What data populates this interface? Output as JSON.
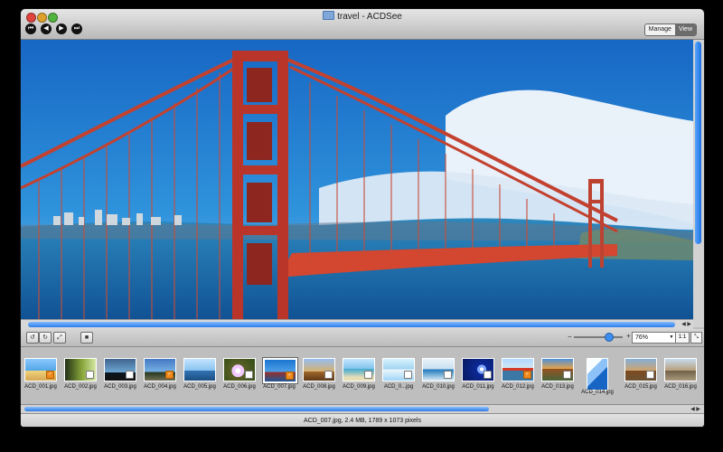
{
  "window": {
    "title": "travel - ACDSee"
  },
  "toolbar": {
    "manage_label": "Manage",
    "view_label": "View"
  },
  "viewer": {
    "zoom_value": "76%",
    "one_to_one_label": "1:1"
  },
  "thumbnails": [
    {
      "label": "ACD_001.jpg"
    },
    {
      "label": "ACD_002.jpg"
    },
    {
      "label": "ACD_003.jpg"
    },
    {
      "label": "ACD_004.jpg"
    },
    {
      "label": "ACD_005.jpg"
    },
    {
      "label": "ACD_006.jpg"
    },
    {
      "label": "ACD_007.jpg"
    },
    {
      "label": "ACD_008.jpg"
    },
    {
      "label": "ACD_009.jpg"
    },
    {
      "label": "ACD_0...jpg"
    },
    {
      "label": "ACD_010.jpg"
    },
    {
      "label": "ACD_011.jpg"
    },
    {
      "label": "ACD_012.jpg"
    },
    {
      "label": "ACD_013.jpg"
    },
    {
      "label": "ACD_014.jpg"
    },
    {
      "label": "ACD_015.jpg"
    },
    {
      "label": "ACD_016.jpg"
    }
  ],
  "status": {
    "text": "ACD_007.jpg, 2.4 MB, 1789 x 1073 pixels"
  },
  "colors": {
    "accent": "#2b7dea",
    "bridge": "#c3412f"
  }
}
